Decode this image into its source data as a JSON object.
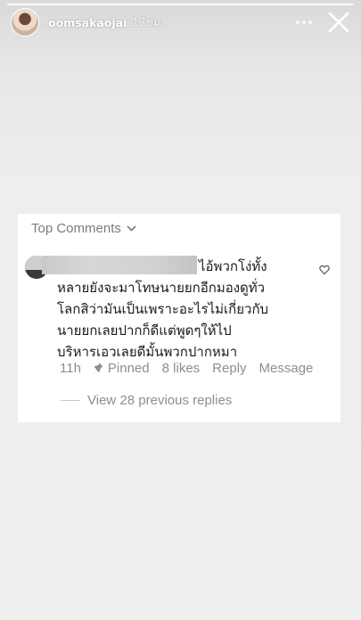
{
  "story": {
    "username": "oomsakaojai",
    "time": "17ชม."
  },
  "card": {
    "header": "Top Comments",
    "comment": {
      "lines": [
        "ไอ้พวกโง่ทั้ง",
        "หลายยังจะมาโทษนายยกอีกมองดูทั่ว",
        "โลกสิว่ามันเป็นเพราะอะไรไม่เกี่ยวกับ",
        "นายยกเลยปากก็ดีแต่พูดๆให้ไป",
        "บริหารเอวเลยดีมั้นพวกปากหมา"
      ]
    },
    "meta": {
      "age": "11h",
      "pinned": "Pinned",
      "likes": "8 likes",
      "reply": "Reply",
      "message": "Message"
    },
    "view_replies": "View 28 previous replies"
  },
  "icons": {
    "more": "more-dots-icon",
    "close": "close-icon",
    "heart": "heart-icon",
    "chevron": "chevron-down-icon",
    "pin": "pin-icon"
  }
}
